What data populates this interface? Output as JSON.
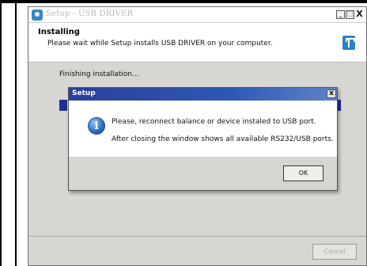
{
  "installer": {
    "window_title": "Setup - USB DRIVER",
    "header_title": "Installing",
    "header_subtitle": "Please wait while Setup installs USB DRIVER on your computer.",
    "status": "Finishing installation...",
    "cancel_label": "Cancel",
    "window_buttons": {
      "minimize": "_",
      "maximize": "□",
      "close": "X"
    }
  },
  "dialog": {
    "title": "Setup",
    "close_glyph": "x",
    "info_glyph": "i",
    "message_line1": "Please, reconnect balance or device instaled to USB port.",
    "message_line2": "After closing the window shows all available RS232/USB ports.",
    "ok_label": "OK"
  },
  "colors": {
    "dialog_title_gradient_start": "#2b3f9c",
    "progress_fill": "#1e2f92",
    "window_background": "#d8d6d2"
  },
  "icons": [
    "setup-app-icon",
    "usb-icon",
    "info-icon",
    "close-icon"
  ]
}
